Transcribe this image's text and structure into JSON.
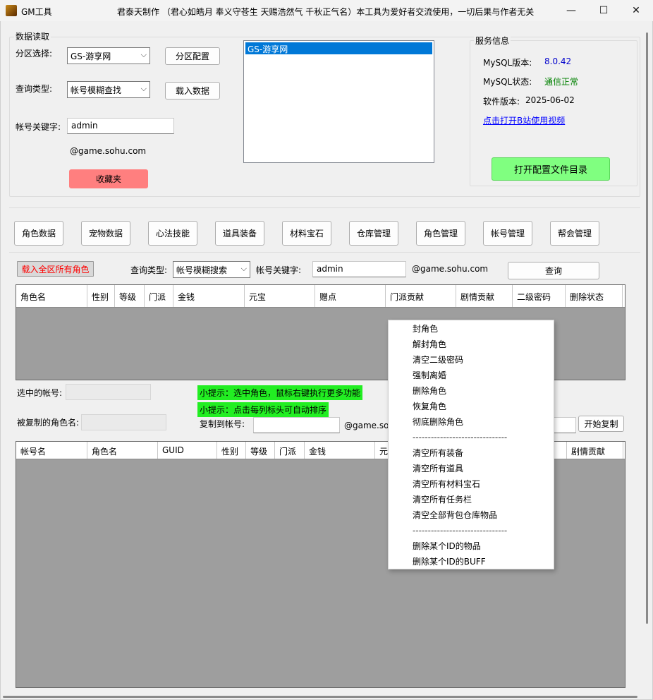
{
  "window": {
    "title": "GM工具",
    "description": "君泰天制作 （君心如皓月 奉义守苍生 天赐浩然气 千秋正气名）本工具为爱好者交流使用，一切后果与作者无关",
    "min_glyph": "—",
    "max_glyph": "☐",
    "close_glyph": "✕"
  },
  "data_read": {
    "legend": "数据读取",
    "zone_label": "分区选择:",
    "zone_value": "GS-游享网",
    "zone_config_button": "分区配置",
    "query_type_label": "查询类型:",
    "query_type_value": "帐号模糊查找",
    "load_data_button": "载入数据",
    "keyword_label": "帐号关键字:",
    "keyword_value": "admin",
    "domain_suffix": "@game.sohu.com",
    "favorites_button": "收藏夹",
    "zone_list": [
      "GS-游享网"
    ]
  },
  "service": {
    "legend": "服务信息",
    "mysql_version_label": "MySQL版本:",
    "mysql_version_value": "8.0.42",
    "mysql_status_label": "MySQL状态:",
    "mysql_status_value": "通信正常",
    "software_version_label": "软件版本:",
    "software_version_value": "2025-06-02",
    "video_link": "点击打开B站使用视频",
    "open_config_button": "打开配置文件目录"
  },
  "tabs": [
    "角色数据",
    "宠物数据",
    "心法技能",
    "道具装备",
    "材料宝石",
    "仓库管理",
    "角色管理",
    "帐号管理",
    "帮会管理"
  ],
  "role_panel": {
    "load_all_button": "载入全区所有角色",
    "query_type_label": "查询类型:",
    "query_type_value": "帐号模糊搜索",
    "keyword_label": "帐号关键字:",
    "keyword_value": "admin",
    "domain_suffix": "@game.sohu.com",
    "query_button": "查询",
    "grid1_columns": [
      "角色名",
      "性别",
      "等级",
      "门派",
      "金钱",
      "元宝",
      "赠点",
      "门派贡献",
      "剧情贡献",
      "二级密码",
      "删除状态"
    ],
    "selected_account_label": "选中的帐号:",
    "selected_account_value": "",
    "hint1": "小提示：选中角色，鼠标右键执行更多功能",
    "hint2": "小提示：点击每列标头可自动排序",
    "copied_role_label": "被复制的角色名:",
    "copied_role_value": "",
    "copy_to_label": "复制到帐号:",
    "copy_to_value": "",
    "copy_domain": "@game.so",
    "copy_target_value": "",
    "start_copy_button": "开始复制",
    "grid2_columns": [
      "帐号名",
      "角色名",
      "GUID",
      "性别",
      "等级",
      "门派",
      "金钱",
      "元",
      "剧情贡献"
    ]
  },
  "context_menu": {
    "items": [
      "封角色",
      "解封角色",
      "清空二级密码",
      "强制离婚",
      "删除角色",
      "恢复角色",
      "彻底删除角色",
      "-------------------------------",
      "清空所有装备",
      "清空所有道具",
      "清空所有材料宝石",
      "清空所有任务栏",
      "清空全部背包仓库物品",
      "-------------------------------",
      "删除某个ID的物品",
      "删除某个ID的BUFF"
    ]
  },
  "colors": {
    "favorites_bg": "#ff7f7f",
    "open_config_bg": "#80ff80",
    "load_all_text": "#ff0000",
    "mysql_version": "#0000cc",
    "mysql_status": "#008000",
    "link": "#0000ff",
    "hint_bg": "#22ee22",
    "grid_bg": "#9e9e9e"
  }
}
